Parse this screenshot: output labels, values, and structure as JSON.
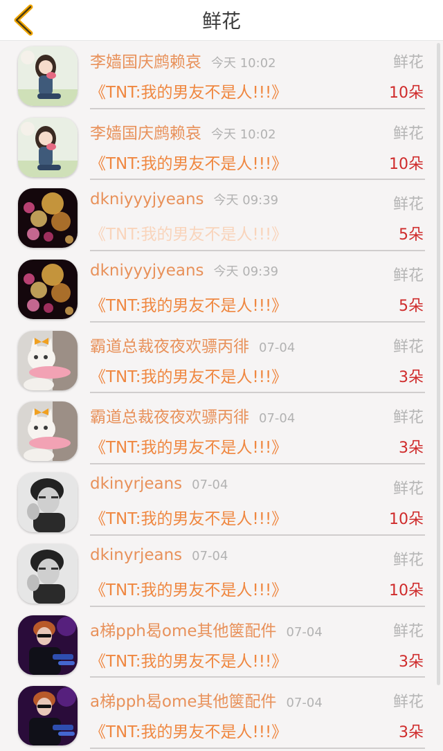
{
  "header": {
    "title": "鲜花",
    "back_icon": "chevron-left-icon",
    "accent_color": "#f0a500"
  },
  "colors": {
    "name": "#e8915a",
    "book": "#ef8740",
    "count": "#cf2b2b",
    "muted": "#b2b2b2"
  },
  "rows": [
    {
      "name": "李嫱国庆鹧赖哀",
      "time": "今天 10:02",
      "kind": "鲜花",
      "book": "《TNT:我的男友不是人!!!》",
      "count": "10朵",
      "avatar": "girl-avatar"
    },
    {
      "name": "李嫱国庆鹧赖哀",
      "time": "今天 10:02",
      "kind": "鲜花",
      "book": "《TNT:我的男友不是人!!!》",
      "count": "10朵",
      "avatar": "girl-avatar"
    },
    {
      "name": "dkniyyyjyeans",
      "time": "今天 09:39",
      "kind": "鲜花",
      "book": "《TNT:我的男友不是人!!!》",
      "count": "5朵",
      "avatar": "bokeh-avatar"
    },
    {
      "name": "dkniyyyjyeans",
      "time": "今天 09:39",
      "kind": "鲜花",
      "book": "《TNT:我的男友不是人!!!》",
      "count": "5朵",
      "avatar": "bokeh-avatar"
    },
    {
      "name": "霸道总裁夜夜欢骠丙徘",
      "time": "07-04",
      "kind": "鲜花",
      "book": "《TNT:我的男友不是人!!!》",
      "count": "3朵",
      "avatar": "cat-avatar"
    },
    {
      "name": "霸道总裁夜夜欢骠丙徘",
      "time": "07-04",
      "kind": "鲜花",
      "book": "《TNT:我的男友不是人!!!》",
      "count": "3朵",
      "avatar": "cat-avatar"
    },
    {
      "name": "dkinyrjeans",
      "time": "07-04",
      "kind": "鲜花",
      "book": "《TNT:我的男友不是人!!!》",
      "count": "10朵",
      "avatar": "boy-avatar"
    },
    {
      "name": "dkinyrjeans",
      "time": "07-04",
      "kind": "鲜花",
      "book": "《TNT:我的男友不是人!!!》",
      "count": "10朵",
      "avatar": "boy-avatar"
    },
    {
      "name": "a梯pph曷ome其他箧配件",
      "time": "07-04",
      "kind": "鲜花",
      "book": "《TNT:我的男友不是人!!!》",
      "count": "3朵",
      "avatar": "singer-avatar"
    },
    {
      "name": "a梯pph曷ome其他箧配件",
      "time": "07-04",
      "kind": "鲜花",
      "book": "《TNT:我的男友不是人!!!》",
      "count": "3朵",
      "avatar": "singer-avatar"
    }
  ]
}
